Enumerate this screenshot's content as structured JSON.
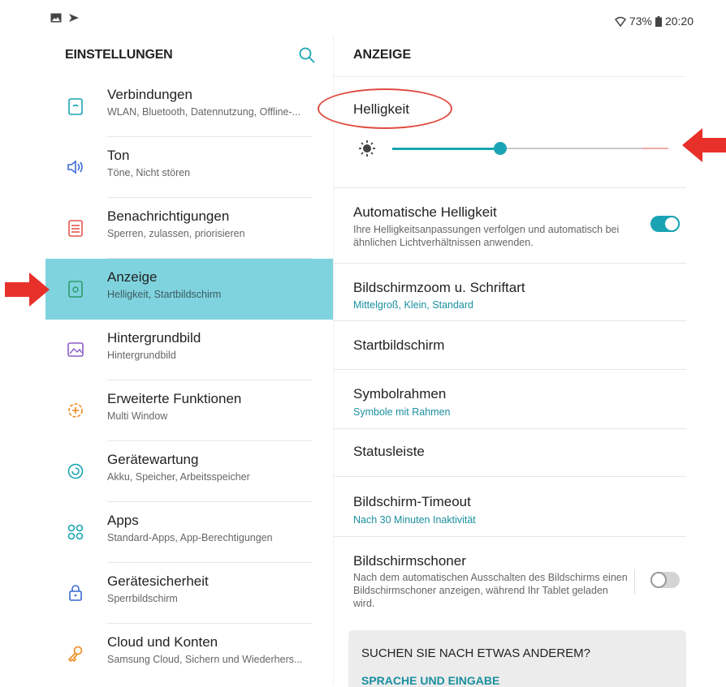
{
  "status_bar": {
    "battery": "73%",
    "time": "20:20"
  },
  "left_panel": {
    "title": "EINSTELLUNGEN",
    "items": [
      {
        "title": "Verbindungen",
        "subtitle": "WLAN, Bluetooth, Datennutzung, Offline-...",
        "icon": "connections-icon"
      },
      {
        "title": "Ton",
        "subtitle": "Töne, Nicht stören",
        "icon": "speaker-icon"
      },
      {
        "title": "Benachrichtigungen",
        "subtitle": "Sperren, zulassen, priorisieren",
        "icon": "notifications-icon"
      },
      {
        "title": "Anzeige",
        "subtitle": "Helligkeit, Startbildschirm",
        "icon": "display-icon",
        "active": true
      },
      {
        "title": "Hintergrundbild",
        "subtitle": "Hintergrundbild",
        "icon": "wallpaper-icon"
      },
      {
        "title": "Erweiterte Funktionen",
        "subtitle": "Multi Window",
        "icon": "advanced-features-icon"
      },
      {
        "title": "Gerätewartung",
        "subtitle": "Akku, Speicher, Arbeitsspeicher",
        "icon": "device-maintenance-icon"
      },
      {
        "title": "Apps",
        "subtitle": "Standard-Apps, App-Berechtigungen",
        "icon": "apps-icon"
      },
      {
        "title": "Gerätesicherheit",
        "subtitle": "Sperrbildschirm",
        "icon": "lock-icon"
      },
      {
        "title": "Cloud und Konten",
        "subtitle": "Samsung Cloud, Sichern und Wiederhers...",
        "icon": "key-icon"
      }
    ]
  },
  "right_panel": {
    "title": "ANZEIGE",
    "brightness": {
      "label": "Helligkeit",
      "level": 0.39
    },
    "rows": {
      "auto_brightness": {
        "title": "Automatische Helligkeit",
        "subtitle": "Ihre Helligkeitsanpassungen verfolgen und automatisch bei ähnlichen Lichtverhältnissen anwenden.",
        "toggle_on": true
      },
      "zoom": {
        "title": "Bildschirmzoom u. Schriftart",
        "subtitle": "Mittelgroß, Klein, Standard"
      },
      "home": {
        "title": "Startbildschirm"
      },
      "icon_frames": {
        "title": "Symbolrahmen",
        "subtitle": "Symbole mit Rahmen"
      },
      "statusbar": {
        "title": "Statusleiste"
      },
      "timeout": {
        "title": "Bildschirm-Timeout",
        "subtitle": "Nach 30 Minuten Inaktivität"
      },
      "screensaver": {
        "title": "Bildschirmschoner",
        "subtitle": "Nach dem automatischen Ausschalten des Bildschirms einen Bildschirmschoner anzeigen, während Ihr Tablet geladen wird.",
        "toggle_on": false
      }
    },
    "suggest": {
      "title": "SUCHEN SIE NACH ETWAS ANDEREM?",
      "link": "SPRACHE UND EINGABE"
    }
  },
  "colors": {
    "accent": "#1aa4b3",
    "active_bg": "#7fd3de",
    "annotation": "#e04c41"
  }
}
